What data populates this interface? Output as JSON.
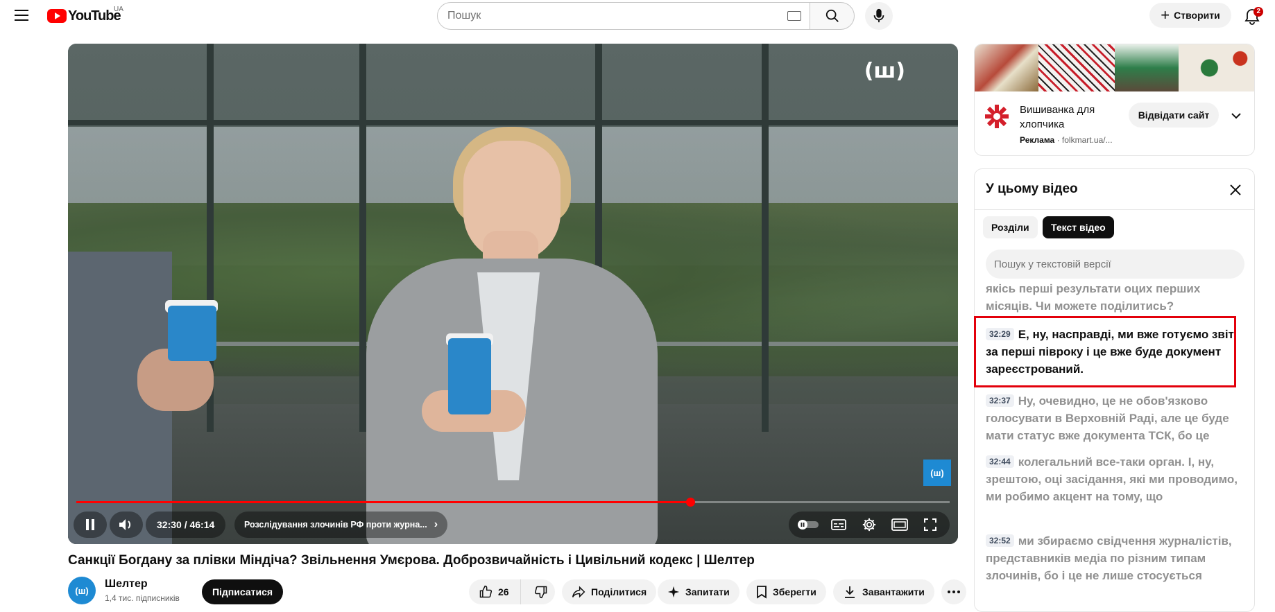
{
  "header": {
    "logo_text": "YouTube",
    "region": "UA",
    "search_placeholder": "Пошук",
    "create_label": "Створити",
    "notifications_count": "2"
  },
  "player": {
    "watermark": "(ш)",
    "corner_logo": "(ш)",
    "time": "32:30 / 46:14",
    "chapter": "Розслідування злочинів РФ проти журна...",
    "progress_fraction": 0.703
  },
  "video": {
    "title": "Санкції Богдану за плівки Міндіча? Звільнення Умєрова. Доброзвичайність і Цивільний кодекс | Шелтер",
    "channel_name": "Шелтер",
    "channel_avatar_text": "(ш)",
    "subscribers": "1,4 тис. підписників",
    "subscribe_label": "Підписатися",
    "likes": "26",
    "share_label": "Поділитися",
    "ask_label": "Запитати",
    "save_label": "Зберегти",
    "download_label": "Завантажити"
  },
  "ad": {
    "title": "Вишиванка для хлопчика",
    "sponsored_label": "Реклама",
    "domain": "folkmart.ua/...",
    "visit_label": "Відвідати сайт"
  },
  "transcript_panel": {
    "title": "У цьому відео",
    "tabs": [
      {
        "label": "Розділи",
        "active": false
      },
      {
        "label": "Текст відео",
        "active": true
      }
    ],
    "search_placeholder": "Пошук у текстовій версії",
    "segments": [
      {
        "time": "",
        "text": "якісь перші результати оцих перших місяців. Чи можете поділитись?",
        "active": false
      },
      {
        "time": "32:29",
        "text": "Е, ну, насправді, ми вже готуємо звіт за перші півроку і це вже буде документ зареєстрований.",
        "active": true
      },
      {
        "time": "32:37",
        "text": "Ну, очевидно, це не обов'язково голосувати в Верховній Раді, але це буде мати статус вже документа ТСК, бо це",
        "active": false
      },
      {
        "time": "32:44",
        "text": "колегальний все-таки орган. І, ну, зрештою, оці засідання, які ми проводимо, ми робимо акцент на тому, що",
        "active": false
      },
      {
        "time": "32:52",
        "text": "ми збираємо свідчення журналістів, представників медіа по різним типам злочинів, бо і це не лише стосується",
        "active": false
      }
    ]
  },
  "colors": {
    "accent_red": "#ff0000",
    "highlight_border": "#e3000b",
    "channel_blue": "#1e8ad3"
  }
}
